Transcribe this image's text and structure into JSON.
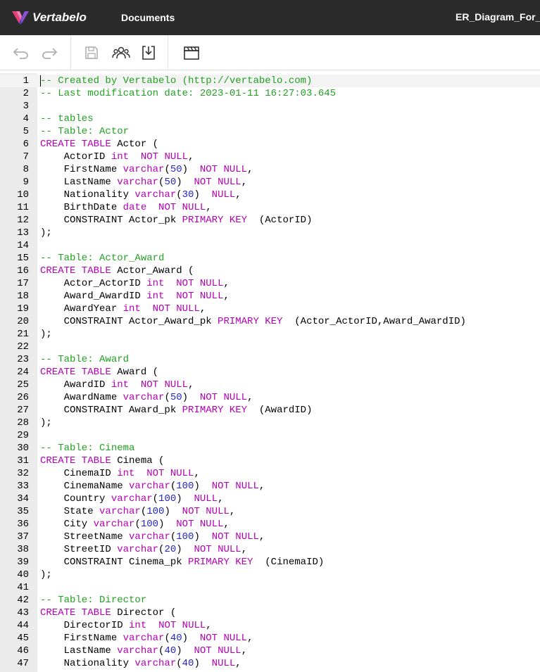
{
  "header": {
    "brand": "Vertabelo",
    "documents_label": "Documents",
    "document_title": "ER_Diagram_For_"
  },
  "toolbar": {
    "items": [
      "undo-icon",
      "redo-icon",
      "save-icon",
      "share-icon",
      "export-icon",
      "sql-clapboard-icon"
    ]
  },
  "editor": {
    "line_numbers": [
      "1",
      "2",
      "3",
      "4",
      "5",
      "6",
      "7",
      "8",
      "9",
      "10",
      "11",
      "12",
      "13",
      "14",
      "15",
      "16",
      "17",
      "18",
      "19",
      "20",
      "21",
      "22",
      "23",
      "24",
      "25",
      "26",
      "27",
      "28",
      "29",
      "30",
      "31",
      "32",
      "33",
      "34",
      "35",
      "36",
      "37",
      "38",
      "39",
      "40",
      "41",
      "42",
      "43",
      "44",
      "45",
      "46",
      "47"
    ],
    "lines": [
      [
        {
          "c": "c",
          "v": "-- Created by Vertabelo (http://vertabelo.com)"
        }
      ],
      [
        {
          "c": "c",
          "v": "-- Last modification date: 2023-01-11 16:27:03.645"
        }
      ],
      [],
      [
        {
          "c": "c",
          "v": "-- tables"
        }
      ],
      [
        {
          "c": "c",
          "v": "-- Table: Actor"
        }
      ],
      [
        {
          "c": "k",
          "v": "CREATE TABLE"
        },
        {
          "c": "",
          "v": " Actor ("
        }
      ],
      [
        {
          "c": "",
          "v": "    ActorID "
        },
        {
          "c": "t",
          "v": "int"
        },
        {
          "c": "",
          "v": "  "
        },
        {
          "c": "k",
          "v": "NOT NULL"
        },
        {
          "c": "",
          "v": ","
        }
      ],
      [
        {
          "c": "",
          "v": "    FirstName "
        },
        {
          "c": "t",
          "v": "varchar"
        },
        {
          "c": "",
          "v": "("
        },
        {
          "c": "n",
          "v": "50"
        },
        {
          "c": "",
          "v": ")  "
        },
        {
          "c": "k",
          "v": "NOT NULL"
        },
        {
          "c": "",
          "v": ","
        }
      ],
      [
        {
          "c": "",
          "v": "    LastName "
        },
        {
          "c": "t",
          "v": "varchar"
        },
        {
          "c": "",
          "v": "("
        },
        {
          "c": "n",
          "v": "50"
        },
        {
          "c": "",
          "v": ")  "
        },
        {
          "c": "k",
          "v": "NOT NULL"
        },
        {
          "c": "",
          "v": ","
        }
      ],
      [
        {
          "c": "",
          "v": "    Nationality "
        },
        {
          "c": "t",
          "v": "varchar"
        },
        {
          "c": "",
          "v": "("
        },
        {
          "c": "n",
          "v": "30"
        },
        {
          "c": "",
          "v": ")  "
        },
        {
          "c": "k",
          "v": "NULL"
        },
        {
          "c": "",
          "v": ","
        }
      ],
      [
        {
          "c": "",
          "v": "    BirthDate "
        },
        {
          "c": "t",
          "v": "date"
        },
        {
          "c": "",
          "v": "  "
        },
        {
          "c": "k",
          "v": "NOT NULL"
        },
        {
          "c": "",
          "v": ","
        }
      ],
      [
        {
          "c": "",
          "v": "    CONSTRAINT Actor_pk "
        },
        {
          "c": "k",
          "v": "PRIMARY KEY"
        },
        {
          "c": "",
          "v": "  (ActorID)"
        }
      ],
      [
        {
          "c": "",
          "v": ");"
        }
      ],
      [],
      [
        {
          "c": "c",
          "v": "-- Table: Actor_Award"
        }
      ],
      [
        {
          "c": "k",
          "v": "CREATE TABLE"
        },
        {
          "c": "",
          "v": " Actor_Award ("
        }
      ],
      [
        {
          "c": "",
          "v": "    Actor_ActorID "
        },
        {
          "c": "t",
          "v": "int"
        },
        {
          "c": "",
          "v": "  "
        },
        {
          "c": "k",
          "v": "NOT NULL"
        },
        {
          "c": "",
          "v": ","
        }
      ],
      [
        {
          "c": "",
          "v": "    Award_AwardID "
        },
        {
          "c": "t",
          "v": "int"
        },
        {
          "c": "",
          "v": "  "
        },
        {
          "c": "k",
          "v": "NOT NULL"
        },
        {
          "c": "",
          "v": ","
        }
      ],
      [
        {
          "c": "",
          "v": "    AwardYear "
        },
        {
          "c": "t",
          "v": "int"
        },
        {
          "c": "",
          "v": "  "
        },
        {
          "c": "k",
          "v": "NOT NULL"
        },
        {
          "c": "",
          "v": ","
        }
      ],
      [
        {
          "c": "",
          "v": "    CONSTRAINT Actor_Award_pk "
        },
        {
          "c": "k",
          "v": "PRIMARY KEY"
        },
        {
          "c": "",
          "v": "  (Actor_ActorID,Award_AwardID)"
        }
      ],
      [
        {
          "c": "",
          "v": ");"
        }
      ],
      [],
      [
        {
          "c": "c",
          "v": "-- Table: Award"
        }
      ],
      [
        {
          "c": "k",
          "v": "CREATE TABLE"
        },
        {
          "c": "",
          "v": " Award ("
        }
      ],
      [
        {
          "c": "",
          "v": "    AwardID "
        },
        {
          "c": "t",
          "v": "int"
        },
        {
          "c": "",
          "v": "  "
        },
        {
          "c": "k",
          "v": "NOT NULL"
        },
        {
          "c": "",
          "v": ","
        }
      ],
      [
        {
          "c": "",
          "v": "    AwardName "
        },
        {
          "c": "t",
          "v": "varchar"
        },
        {
          "c": "",
          "v": "("
        },
        {
          "c": "n",
          "v": "50"
        },
        {
          "c": "",
          "v": ")  "
        },
        {
          "c": "k",
          "v": "NOT NULL"
        },
        {
          "c": "",
          "v": ","
        }
      ],
      [
        {
          "c": "",
          "v": "    CONSTRAINT Award_pk "
        },
        {
          "c": "k",
          "v": "PRIMARY KEY"
        },
        {
          "c": "",
          "v": "  (AwardID)"
        }
      ],
      [
        {
          "c": "",
          "v": ");"
        }
      ],
      [],
      [
        {
          "c": "c",
          "v": "-- Table: Cinema"
        }
      ],
      [
        {
          "c": "k",
          "v": "CREATE TABLE"
        },
        {
          "c": "",
          "v": " Cinema ("
        }
      ],
      [
        {
          "c": "",
          "v": "    CinemaID "
        },
        {
          "c": "t",
          "v": "int"
        },
        {
          "c": "",
          "v": "  "
        },
        {
          "c": "k",
          "v": "NOT NULL"
        },
        {
          "c": "",
          "v": ","
        }
      ],
      [
        {
          "c": "",
          "v": "    CinemaName "
        },
        {
          "c": "t",
          "v": "varchar"
        },
        {
          "c": "",
          "v": "("
        },
        {
          "c": "n",
          "v": "100"
        },
        {
          "c": "",
          "v": ")  "
        },
        {
          "c": "k",
          "v": "NOT NULL"
        },
        {
          "c": "",
          "v": ","
        }
      ],
      [
        {
          "c": "",
          "v": "    Country "
        },
        {
          "c": "t",
          "v": "varchar"
        },
        {
          "c": "",
          "v": "("
        },
        {
          "c": "n",
          "v": "100"
        },
        {
          "c": "",
          "v": ")  "
        },
        {
          "c": "k",
          "v": "NULL"
        },
        {
          "c": "",
          "v": ","
        }
      ],
      [
        {
          "c": "",
          "v": "    State "
        },
        {
          "c": "t",
          "v": "varchar"
        },
        {
          "c": "",
          "v": "("
        },
        {
          "c": "n",
          "v": "100"
        },
        {
          "c": "",
          "v": ")  "
        },
        {
          "c": "k",
          "v": "NOT NULL"
        },
        {
          "c": "",
          "v": ","
        }
      ],
      [
        {
          "c": "",
          "v": "    City "
        },
        {
          "c": "t",
          "v": "varchar"
        },
        {
          "c": "",
          "v": "("
        },
        {
          "c": "n",
          "v": "100"
        },
        {
          "c": "",
          "v": ")  "
        },
        {
          "c": "k",
          "v": "NOT NULL"
        },
        {
          "c": "",
          "v": ","
        }
      ],
      [
        {
          "c": "",
          "v": "    StreetName "
        },
        {
          "c": "t",
          "v": "varchar"
        },
        {
          "c": "",
          "v": "("
        },
        {
          "c": "n",
          "v": "100"
        },
        {
          "c": "",
          "v": ")  "
        },
        {
          "c": "k",
          "v": "NOT NULL"
        },
        {
          "c": "",
          "v": ","
        }
      ],
      [
        {
          "c": "",
          "v": "    StreetID "
        },
        {
          "c": "t",
          "v": "varchar"
        },
        {
          "c": "",
          "v": "("
        },
        {
          "c": "n",
          "v": "20"
        },
        {
          "c": "",
          "v": ")  "
        },
        {
          "c": "k",
          "v": "NOT NULL"
        },
        {
          "c": "",
          "v": ","
        }
      ],
      [
        {
          "c": "",
          "v": "    CONSTRAINT Cinema_pk "
        },
        {
          "c": "k",
          "v": "PRIMARY KEY"
        },
        {
          "c": "",
          "v": "  (CinemaID)"
        }
      ],
      [
        {
          "c": "",
          "v": ");"
        }
      ],
      [],
      [
        {
          "c": "c",
          "v": "-- Table: Director"
        }
      ],
      [
        {
          "c": "k",
          "v": "CREATE TABLE"
        },
        {
          "c": "",
          "v": " Director ("
        }
      ],
      [
        {
          "c": "",
          "v": "    DirectorID "
        },
        {
          "c": "t",
          "v": "int"
        },
        {
          "c": "",
          "v": "  "
        },
        {
          "c": "k",
          "v": "NOT NULL"
        },
        {
          "c": "",
          "v": ","
        }
      ],
      [
        {
          "c": "",
          "v": "    FirstName "
        },
        {
          "c": "t",
          "v": "varchar"
        },
        {
          "c": "",
          "v": "("
        },
        {
          "c": "n",
          "v": "40"
        },
        {
          "c": "",
          "v": ")  "
        },
        {
          "c": "k",
          "v": "NOT NULL"
        },
        {
          "c": "",
          "v": ","
        }
      ],
      [
        {
          "c": "",
          "v": "    LastName "
        },
        {
          "c": "t",
          "v": "varchar"
        },
        {
          "c": "",
          "v": "("
        },
        {
          "c": "n",
          "v": "40"
        },
        {
          "c": "",
          "v": ")  "
        },
        {
          "c": "k",
          "v": "NOT NULL"
        },
        {
          "c": "",
          "v": ","
        }
      ],
      [
        {
          "c": "",
          "v": "    Nationality "
        },
        {
          "c": "t",
          "v": "varchar"
        },
        {
          "c": "",
          "v": "("
        },
        {
          "c": "n",
          "v": "40"
        },
        {
          "c": "",
          "v": ")  "
        },
        {
          "c": "k",
          "v": "NULL"
        },
        {
          "c": "",
          "v": ","
        }
      ]
    ]
  },
  "colors": {
    "header_bg": "#2b2b2b",
    "comment": "#22a022",
    "keyword": "#b500b5",
    "number": "#2424c8",
    "gutter_bg": "#ebebeb"
  }
}
